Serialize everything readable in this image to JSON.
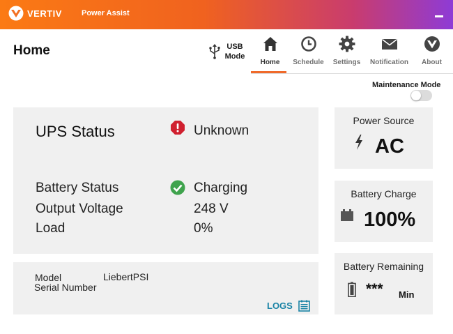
{
  "header": {
    "brand": "VERTIV",
    "app_name": "Power Assist"
  },
  "page": {
    "title": "Home"
  },
  "usb": {
    "label_line1": "USB",
    "label_line2": "Mode"
  },
  "nav": {
    "tabs": [
      {
        "label": "Home",
        "icon": "home-icon",
        "active": true
      },
      {
        "label": "Schedule",
        "icon": "clock-icon",
        "active": false
      },
      {
        "label": "Settings",
        "icon": "gear-icon",
        "active": false
      },
      {
        "label": "Notification",
        "icon": "envelope-icon",
        "active": false
      },
      {
        "label": "About",
        "icon": "vertiv-shield-icon",
        "active": false
      }
    ]
  },
  "maintenance": {
    "label": "Maintenance Mode",
    "enabled": false
  },
  "ups": {
    "title": "UPS Status",
    "state": "Unknown",
    "state_color": "#d0202f",
    "rows": [
      {
        "label": "Battery Status",
        "value": "Charging"
      },
      {
        "label": "Output Voltage",
        "value": "248 V"
      },
      {
        "label": "Load",
        "value": "0%"
      }
    ],
    "ok_color": "#3fa34d"
  },
  "info": {
    "model_label": "Model",
    "model_value": "LiebertPSI",
    "serial_label": "Serial Number",
    "logs_label": "LOGS"
  },
  "cards": {
    "power_source": {
      "title": "Power Source",
      "value": "AC"
    },
    "battery_charge": {
      "title": "Battery Charge",
      "value": "100%"
    },
    "battery_remaining": {
      "title": "Battery Remaining",
      "value": "***",
      "unit": "Min"
    }
  },
  "colors": {
    "accent": "#f06a2a",
    "link": "#1b84a6",
    "panel_bg": "#f0f0f0"
  }
}
